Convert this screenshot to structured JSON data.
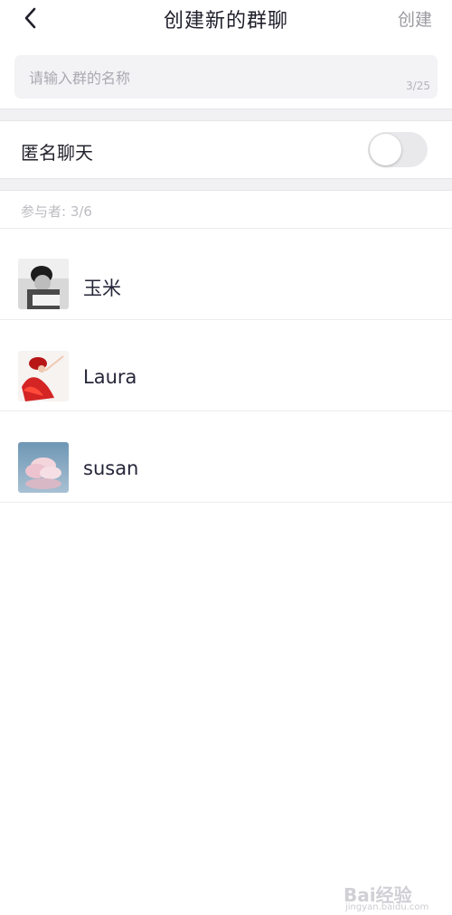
{
  "header": {
    "title": "创建新的群聊",
    "create_label": "创建"
  },
  "group_name": {
    "placeholder": "请输入群的名称",
    "value": "",
    "char_count": "3/25"
  },
  "anonymous_chat": {
    "label": "匿名聊天",
    "enabled": false
  },
  "participants": {
    "label": "参与者: 3/6",
    "members": [
      {
        "name": "玉米",
        "avatar": "bw-boy-reading"
      },
      {
        "name": "Laura",
        "avatar": "red-dancer"
      },
      {
        "name": "susan",
        "avatar": "pink-clouds"
      }
    ]
  },
  "watermark": {
    "text": "Bai经验",
    "sub": "jingyan.baidu.com"
  },
  "colors": {
    "accent_text": "#26263a",
    "muted": "#9a9aa0",
    "band": "#f1f1f4"
  }
}
